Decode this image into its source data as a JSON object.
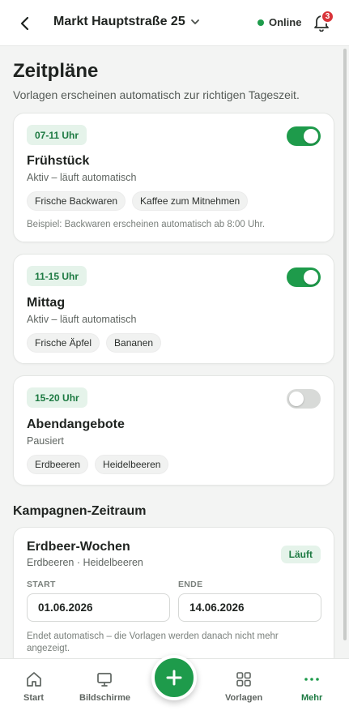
{
  "header": {
    "store_name": "Markt Hauptstraße 25",
    "status": "Online",
    "notification_count": "3"
  },
  "page": {
    "title": "Zeitpläne",
    "subtitle": "Vorlagen erscheinen automatisch zur richtigen Tageszeit."
  },
  "schedules": [
    {
      "time": "07-11 Uhr",
      "title": "Frühstück",
      "status": "Aktiv – läuft automatisch",
      "enabled": true,
      "chips": [
        "Frische Backwaren",
        "Kaffee zum Mitnehmen"
      ],
      "note": "Beispiel: Backwaren erscheinen automatisch ab 8:00 Uhr."
    },
    {
      "time": "11-15 Uhr",
      "title": "Mittag",
      "status": "Aktiv – läuft automatisch",
      "enabled": true,
      "chips": [
        "Frische Äpfel",
        "Bananen"
      ]
    },
    {
      "time": "15-20 Uhr",
      "title": "Abendangebote",
      "status": "Pausiert",
      "enabled": false,
      "chips": [
        "Erdbeeren",
        "Heidelbeeren"
      ]
    }
  ],
  "campaign_section": {
    "title": "Kampagnen-Zeitraum",
    "campaign": {
      "title": "Erdbeer-Wochen",
      "items": "Erdbeeren · Heidelbeeren",
      "status": "Läuft",
      "start_label": "START",
      "start_value": "01.06.2026",
      "end_label": "ENDE",
      "end_value": "14.06.2026",
      "note": "Endet automatisch – die Vorlagen werden danach nicht mehr angezeigt."
    }
  },
  "bottom_nav": {
    "start": "Start",
    "screens": "Bildschirme",
    "templates": "Vorlagen",
    "more": "Mehr"
  },
  "colors": {
    "accent": "#1e9b4b",
    "badge": "#d9343a"
  }
}
